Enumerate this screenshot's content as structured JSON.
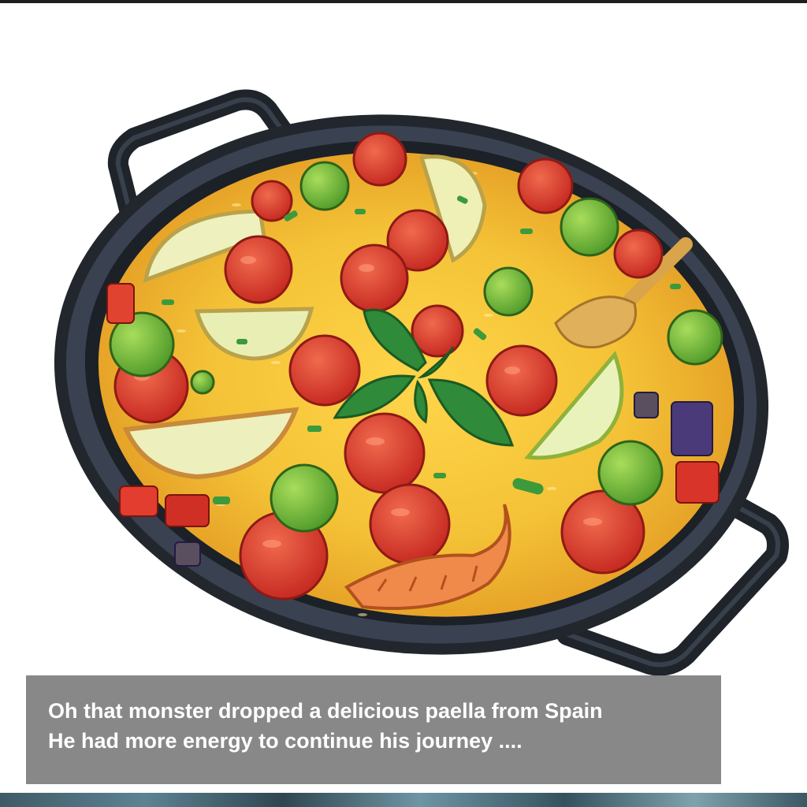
{
  "dialog": {
    "line1": "Oh that monster dropped a delicious paella from Spain",
    "line2": "He had more energy to continue his journey ...."
  },
  "scene": {
    "item_icon": "paella-pan-icon",
    "colors": {
      "pan": "#262b33",
      "rice": "#f2c23a",
      "tomato": "#d8342a",
      "olive": "#74b83a",
      "lemon": "#e7ebb0",
      "basil": "#2f8a3a",
      "dialog_bg": "#787878"
    }
  }
}
